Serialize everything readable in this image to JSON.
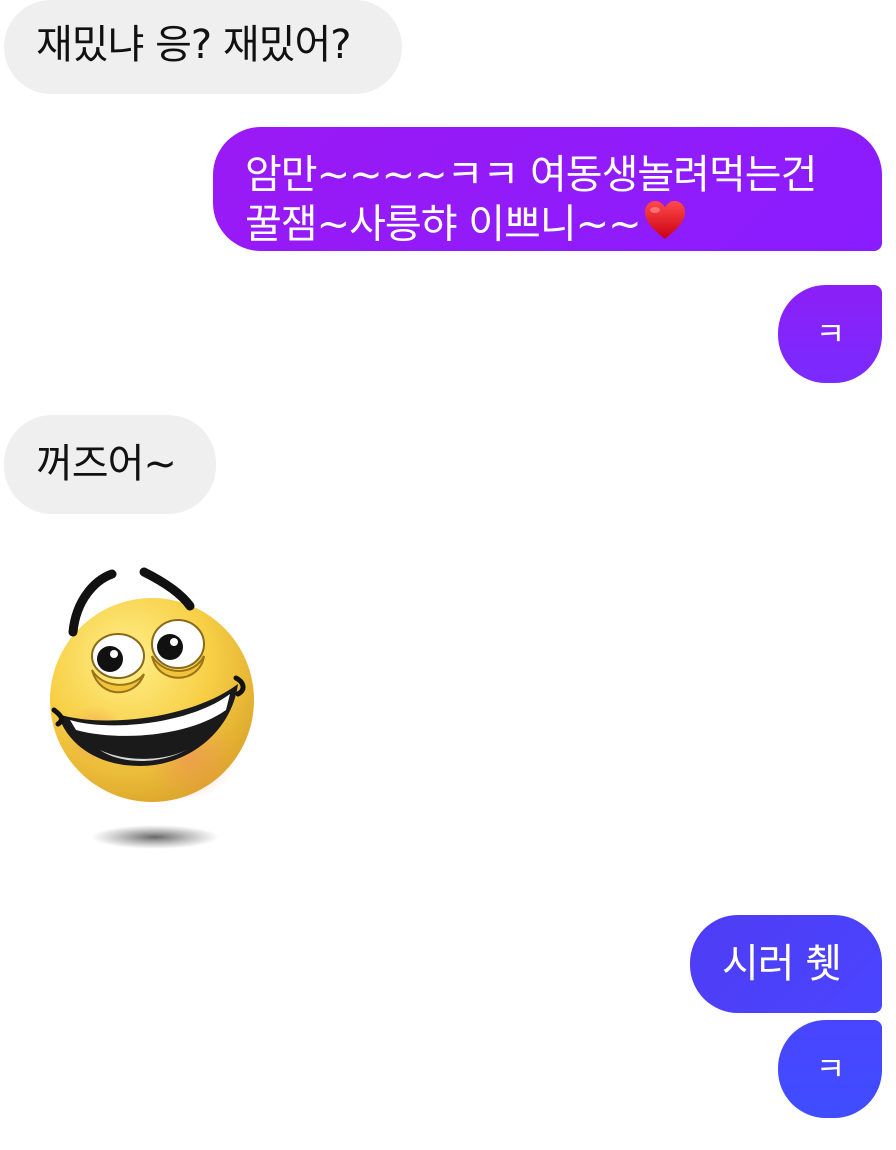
{
  "messages": [
    {
      "side": "received",
      "text": "재밌냐 응? 재밌어?"
    },
    {
      "side": "sent",
      "lines": [
        "암만~~~~ㅋㅋ 여동생놀려먹는건",
        "꿀잼~사릉햐 이쁘니~~"
      ],
      "trailing_icon": "heart-icon"
    },
    {
      "side": "sent",
      "text": "ㅋ"
    },
    {
      "side": "received",
      "text": "꺼즈어~"
    },
    {
      "side": "received",
      "sticker": "laughing-emoji-sticker"
    },
    {
      "side": "sent",
      "text": "시러 췟"
    },
    {
      "side": "sent",
      "text": "ㅋ"
    }
  ],
  "colors": {
    "received_bubble": "#efefef",
    "sent_purple": "#9a1af4",
    "sent_blue": "#4a45ff",
    "heart": "#e8141f"
  }
}
